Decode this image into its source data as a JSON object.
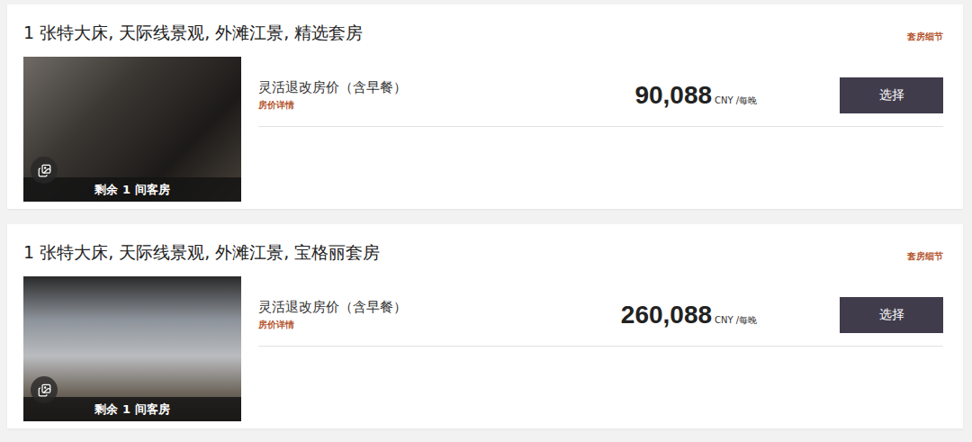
{
  "rooms": [
    {
      "title": "1 张特大床, 天际线景观, 外滩江景, 精选套房",
      "details_link": "套房细节",
      "remaining": "剩余 1 间客房",
      "rate_name": "灵活退改房价（含早餐）",
      "rate_details": "房价详情",
      "price": "90,088",
      "currency": "CNY",
      "per_night": "/每晚",
      "button": "选择"
    },
    {
      "title": "1 张特大床, 天际线景观, 外滩江景, 宝格丽套房",
      "details_link": "套房细节",
      "remaining": "剩余 1 间客房",
      "rate_name": "灵活退改房价（含早餐）",
      "rate_details": "房价详情",
      "price": "260,088",
      "currency": "CNY",
      "per_night": "/每晚",
      "button": "选择"
    }
  ]
}
